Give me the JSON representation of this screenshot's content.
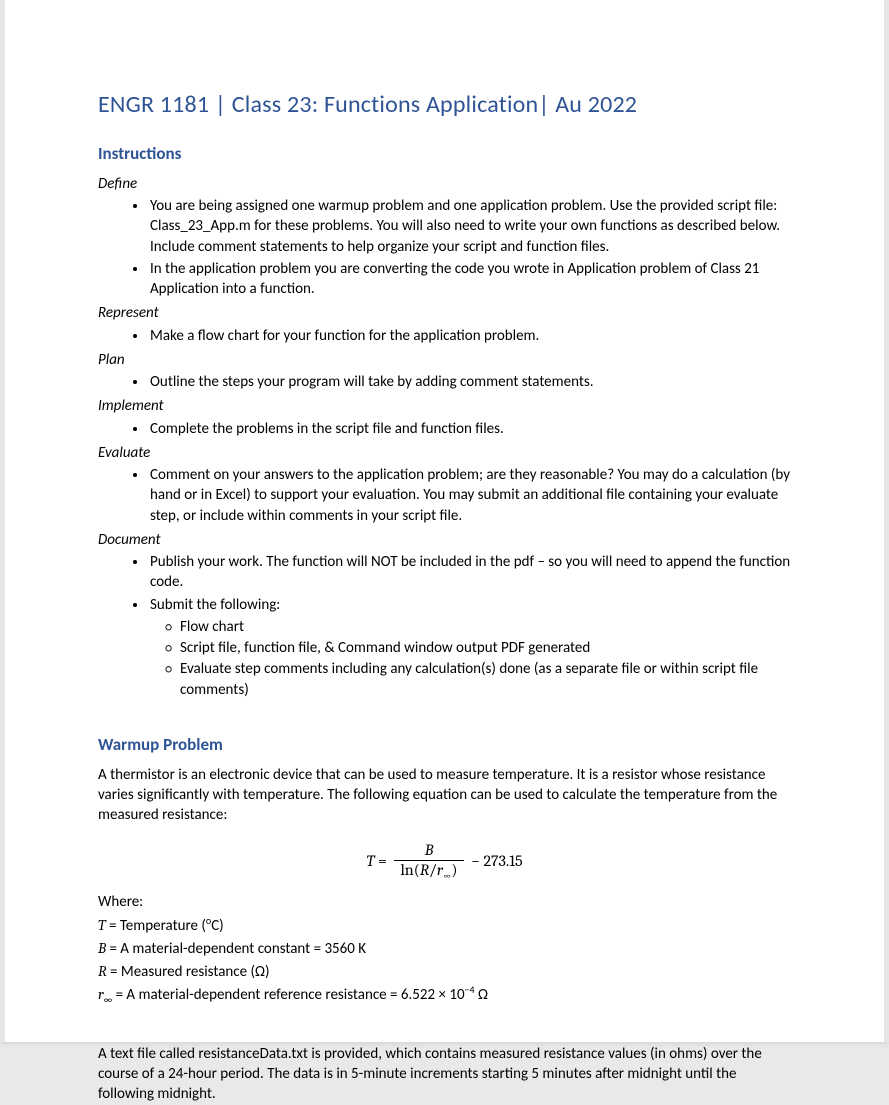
{
  "header": {
    "title": "ENGR 1181 | Class 23: Functions Application| Au 2022"
  },
  "instructions": {
    "heading": "Instructions",
    "define": {
      "label": "Define",
      "items": [
        "You are being assigned one warmup problem and one application problem.  Use the provided script file: Class_23_App.m for these problems. You will also need to write your own functions as described below. Include comment statements to help organize your script and function files.",
        "In the application problem you are converting the code you wrote in Application problem of Class 21 Application into a function."
      ]
    },
    "represent": {
      "label": "Represent",
      "items": [
        "Make a flow chart for your function for the application problem."
      ]
    },
    "plan": {
      "label": "Plan",
      "items": [
        "Outline the steps your program will take by adding comment statements."
      ]
    },
    "implement": {
      "label": "Implement",
      "items": [
        "Complete the problems in the script file and function files."
      ]
    },
    "evaluate": {
      "label": "Evaluate",
      "items": [
        "Comment on your answers to the application problem; are they reasonable? You may do a calculation (by hand or in Excel) to support your evaluation. You may submit an additional file containing your evaluate step, or include within comments in your script file."
      ]
    },
    "document": {
      "label": "Document",
      "items": [
        "Publish your work. The function will NOT be included in the pdf – so you will need to append the function code.",
        "Submit the following:"
      ],
      "submit_sub": [
        "Flow chart",
        "Script file, function file, & Command window output PDF generated",
        "Evaluate step comments including any calculation(s) done (as a separate file or within script file comments)"
      ]
    }
  },
  "warmup": {
    "heading": "Warmup Problem",
    "intro": "A thermistor is an electronic device that can be used to measure temperature. It is a resistor whose resistance varies significantly with temperature. The following equation can be used to calculate the temperature from the measured resistance:",
    "equation": {
      "lhs": "T",
      "eq": "=",
      "num": "B",
      "den_pre": "ln(",
      "den_R": "R",
      "den_slash": "/",
      "den_rinf": "r",
      "den_inf": "∞",
      "den_post": ")",
      "tail": "− 273.15"
    },
    "where_label": "Where:",
    "defs": {
      "T_sym": "T",
      "T_text": " = Temperature (",
      "T_sup": "o",
      "T_tail": "C)",
      "B_sym": "B",
      "B_text": " = A material-dependent constant = 3560 K",
      "R_sym": "R",
      "R_text": " = Measured resistance (Ω)",
      "rinf_sym": "r",
      "rinf_sub": "∞",
      "rinf_text": " = A material-dependent reference resistance = 6.522 × 10",
      "rinf_exp": "−4",
      "rinf_tail": " Ω"
    },
    "datafile_para": "A text file called resistanceData.txt is provided, which contains measured resistance values (in ohms) over the course of a 24-hour period. The data is in 5-minute increments starting 5 minutes after midnight until the following midnight."
  }
}
